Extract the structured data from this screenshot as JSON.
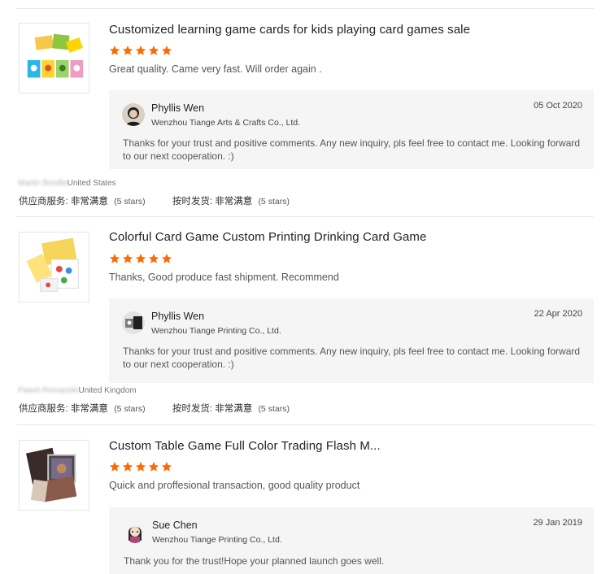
{
  "colors": {
    "star": "#ff6a00",
    "reply_bg": "#f5f5f6",
    "divider": "#e8e8e8"
  },
  "reviews": [
    {
      "product_title": "Customized learning game cards for kids playing card games sale",
      "rating": 5,
      "comment": "Great quality. Came very fast. Will order again .",
      "thumbnail_icon": "kids-game-cards-product-image",
      "reply": {
        "avatar_icon": "seller-avatar-photo",
        "seller_name": "Phyllis Wen",
        "company": "Wenzhou Tiange Arts & Crafts Co., Ltd.",
        "date": "05 Oct 2020",
        "text": "Thanks for your trust and positive comments. Any new inquiry, pls feel free to contact me. Looking forward to our next cooperation. :)"
      },
      "buyer": {
        "name_blurred": "Martin Bonilla",
        "country": "United States"
      },
      "ratings": [
        {
          "label": "供应商服务:",
          "value": "非常满意",
          "count": "(5 stars)"
        },
        {
          "label": "按时发货:",
          "value": "非常满意",
          "count": "(5 stars)"
        }
      ]
    },
    {
      "product_title": "Colorful Card Game Custom Printing Drinking Card Game",
      "rating": 5,
      "comment": "Thanks, Good produce fast shipment. Recommend",
      "thumbnail_icon": "colorful-card-game-product-image",
      "reply": {
        "avatar_icon": "seller-avatar-logo",
        "seller_name": "Phyllis Wen",
        "company": "Wenzhou Tiange Printing Co., Ltd.",
        "date": "22 Apr 2020",
        "text": "Thanks for your trust and positive comments. Any new inquiry, pls feel free to contact me. Looking forward to our next cooperation. :)"
      },
      "buyer": {
        "name_blurred": "Pawel Romanski",
        "country": "United Kingdom"
      },
      "ratings": [
        {
          "label": "供应商服务:",
          "value": "非常满意",
          "count": "(5 stars)"
        },
        {
          "label": "按时发货:",
          "value": "非常满意",
          "count": "(5 stars)"
        }
      ]
    },
    {
      "product_title": "Custom Table Game Full Color Trading Flash M...",
      "rating": 5,
      "comment": "Quick and proffesional transaction, good quality product",
      "thumbnail_icon": "table-game-cards-product-image",
      "reply": {
        "avatar_icon": "seller-avatar-cartoon",
        "seller_name": "Sue Chen",
        "company": "Wenzhou Tiange Printing Co., Ltd.",
        "date": "29 Jan 2019",
        "text": "Thank you for the trust!Hope your planned launch goes well."
      }
    }
  ]
}
